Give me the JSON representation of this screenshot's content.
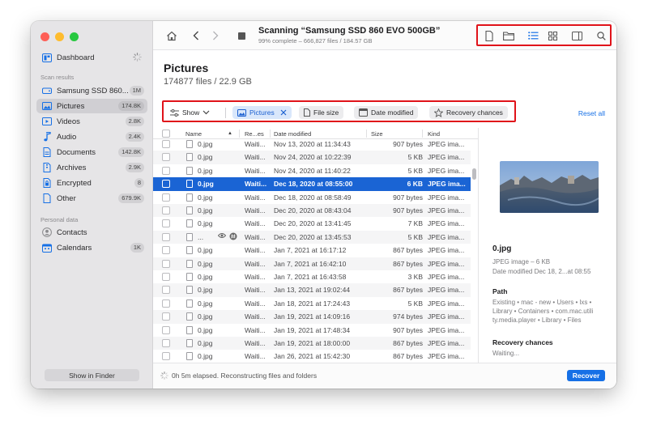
{
  "colors": {
    "accent": "#1670e6",
    "selection": "#1a64d4",
    "highlight_box": "#e0131a"
  },
  "sidebar": {
    "dashboard": {
      "label": "Dashboard",
      "icon": "dashboard-icon"
    },
    "scan_results_heading": "Scan results",
    "scan_items": [
      {
        "label": "Samsung SSD 860...",
        "count": "1M",
        "icon": "drive-icon"
      },
      {
        "label": "Pictures",
        "count": "174.8K",
        "icon": "picture-icon"
      },
      {
        "label": "Videos",
        "count": "2.8K",
        "icon": "video-icon"
      },
      {
        "label": "Audio",
        "count": "2.4K",
        "icon": "music-note-icon"
      },
      {
        "label": "Documents",
        "count": "142.8K",
        "icon": "document-icon"
      },
      {
        "label": "Archives",
        "count": "2.9K",
        "icon": "archive-icon"
      },
      {
        "label": "Encrypted",
        "count": "8",
        "icon": "lock-icon"
      },
      {
        "label": "Other",
        "count": "679.9K",
        "icon": "other-file-icon"
      }
    ],
    "personal_heading": "Personal data",
    "personal_items": [
      {
        "label": "Contacts",
        "count": "",
        "icon": "contacts-icon"
      },
      {
        "label": "Calendars",
        "count": "1K",
        "icon": "calendar-icon"
      }
    ],
    "show_in_finder": "Show in Finder"
  },
  "toolbar": {
    "title": "Scanning “Samsung SSD 860 EVO 500GB”",
    "subtitle": "99% complete – 666,827 files / 184.57 GB",
    "progress_percent": 99
  },
  "header": {
    "title": "Pictures",
    "subtitle": "174877 files / 22.9 GB"
  },
  "filters": {
    "show_label": "Show",
    "pictures_label": "Pictures",
    "file_size_label": "File size",
    "date_modified_label": "Date modified",
    "recovery_chances_label": "Recovery chances",
    "reset_all": "Reset all"
  },
  "table": {
    "columns": {
      "name": "Name",
      "recovery": "Re...es",
      "date": "Date modified",
      "size": "Size",
      "kind": "Kind"
    },
    "rows": [
      {
        "name": "0.jpg",
        "rec": "Waiti...",
        "date": "Nov 13, 2020 at 11:34:43",
        "size": "907 bytes",
        "kind": "JPEG ima..."
      },
      {
        "name": "0.jpg",
        "rec": "Waiti...",
        "date": "Nov 24, 2020 at 10:22:39",
        "size": "5 KB",
        "kind": "JPEG ima..."
      },
      {
        "name": "0.jpg",
        "rec": "Waiti...",
        "date": "Nov 24, 2020 at 11:40:22",
        "size": "5 KB",
        "kind": "JPEG ima..."
      },
      {
        "name": "0.jpg",
        "rec": "Waiti...",
        "date": "Dec 18, 2020 at 08:55:00",
        "size": "6 KB",
        "kind": "JPEG ima..."
      },
      {
        "name": "0.jpg",
        "rec": "Waiti...",
        "date": "Dec 18, 2020 at 08:58:49",
        "size": "907 bytes",
        "kind": "JPEG ima..."
      },
      {
        "name": "0.jpg",
        "rec": "Waiti...",
        "date": "Dec 20, 2020 at 08:43:04",
        "size": "907 bytes",
        "kind": "JPEG ima..."
      },
      {
        "name": "0.jpg",
        "rec": "Waiti...",
        "date": "Dec 20, 2020 at 13:41:45",
        "size": "7 KB",
        "kind": "JPEG ima..."
      },
      {
        "name": "...",
        "rec": "Waiti...",
        "date": "Dec 20, 2020 at 13:45:53",
        "size": "5 KB",
        "kind": "JPEG ima..."
      },
      {
        "name": "0.jpg",
        "rec": "Waiti...",
        "date": "Jan 7, 2021 at 16:17:12",
        "size": "867 bytes",
        "kind": "JPEG ima..."
      },
      {
        "name": "0.jpg",
        "rec": "Waiti...",
        "date": "Jan 7, 2021 at 16:42:10",
        "size": "867 bytes",
        "kind": "JPEG ima..."
      },
      {
        "name": "0.jpg",
        "rec": "Waiti...",
        "date": "Jan 7, 2021 at 16:43:58",
        "size": "3 KB",
        "kind": "JPEG ima..."
      },
      {
        "name": "0.jpg",
        "rec": "Waiti...",
        "date": "Jan 13, 2021 at 19:02:44",
        "size": "867 bytes",
        "kind": "JPEG ima..."
      },
      {
        "name": "0.jpg",
        "rec": "Waiti...",
        "date": "Jan 18, 2021 at 17:24:43",
        "size": "5 KB",
        "kind": "JPEG ima..."
      },
      {
        "name": "0.jpg",
        "rec": "Waiti...",
        "date": "Jan 19, 2021 at 14:09:16",
        "size": "974 bytes",
        "kind": "JPEG ima..."
      },
      {
        "name": "0.jpg",
        "rec": "Waiti...",
        "date": "Jan 19, 2021 at 17:48:34",
        "size": "907 bytes",
        "kind": "JPEG ima..."
      },
      {
        "name": "0.jpg",
        "rec": "Waiti...",
        "date": "Jan 19, 2021 at 18:00:00",
        "size": "867 bytes",
        "kind": "JPEG ima..."
      },
      {
        "name": "0.jpg",
        "rec": "Waiti...",
        "date": "Jan 26, 2021 at 15:42:30",
        "size": "867 bytes",
        "kind": "JPEG ima..."
      }
    ],
    "selected_index": 3
  },
  "preview": {
    "file_name": "0.jpg",
    "file_type": "JPEG image – 6 KB",
    "date_modified": "Date modified  Dec 18, 2...at 08:55",
    "path_heading": "Path",
    "path_lines": [
      "Existing • mac - new • Users • lxs •",
      "Library • Containers • com.mac.utili",
      "ty.media.player • Library • Files"
    ],
    "recovery_heading": "Recovery chances",
    "recovery_value": "Waiting..."
  },
  "status": {
    "text": "0h 5m elapsed. Reconstructing files and folders",
    "recover_label": "Recover"
  }
}
